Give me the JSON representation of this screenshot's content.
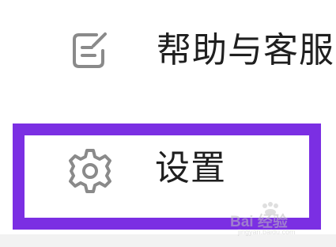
{
  "menu": {
    "items": [
      {
        "label": "帮助与客服",
        "icon": "edit-note-icon"
      },
      {
        "label": "设置",
        "icon": "gear-icon"
      }
    ]
  },
  "highlight": {
    "color": "#7b2fe3",
    "target": "settings"
  },
  "watermark": {
    "main": "Bai 经验",
    "sub": "jingyan.baidu.com"
  }
}
